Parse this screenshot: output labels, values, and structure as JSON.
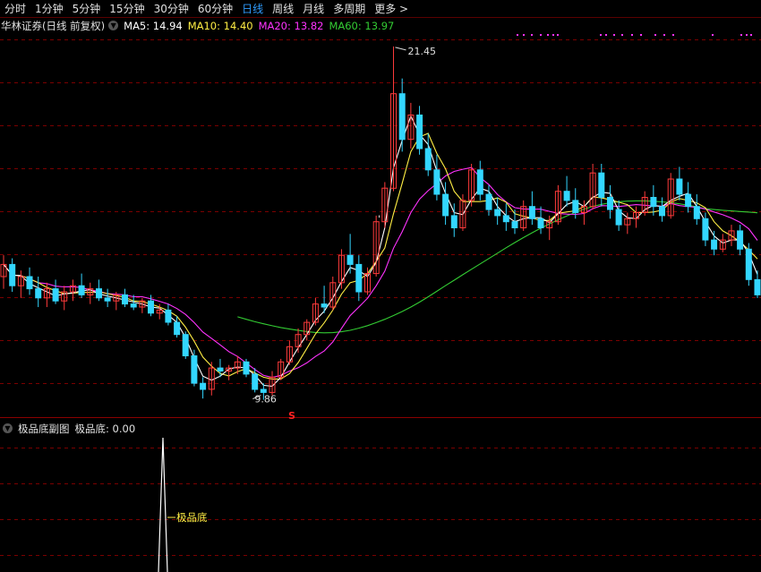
{
  "period_tabs": [
    "分时",
    "1分钟",
    "5分钟",
    "15分钟",
    "30分钟",
    "60分钟",
    "日线",
    "周线",
    "月线",
    "多周期",
    "更多 >"
  ],
  "active_tab": "日线",
  "main_panel": {
    "stock_title": "华林证券(日线 前复权)",
    "ma5_label": "MA5: 14.94",
    "ma10_label": "MA10: 14.40",
    "ma20_label": "MA20: 13.82",
    "ma60_label": "MA60: 13.97",
    "high_marker": "21.45",
    "low_marker": "9.86",
    "signal_marker": "S",
    "tick_marker": "'"
  },
  "sub_panel": {
    "title": "极品底副图",
    "value_label": "极品底: 0.00",
    "annotation": "极品底"
  },
  "colors": {
    "up": "#ff3b3b",
    "down": "#33d6ff",
    "ma5": "#ffffff",
    "ma10": "#ffee44",
    "ma20": "#ff33ff",
    "ma60": "#33cc33",
    "grid": "#7a0000",
    "active_tab": "#2f9dff"
  },
  "chart_data": {
    "type": "candlestick",
    "price_extremes": {
      "high": 21.45,
      "low": 9.86
    },
    "ohlc_approx": [
      [
        13.9,
        14.6,
        13.5,
        14.3
      ],
      [
        14.3,
        14.5,
        13.4,
        13.6
      ],
      [
        13.6,
        14.1,
        13.2,
        13.9
      ],
      [
        13.9,
        14.2,
        13.3,
        13.5
      ],
      [
        13.5,
        13.9,
        12.9,
        13.2
      ],
      [
        13.2,
        13.7,
        12.9,
        13.5
      ],
      [
        13.5,
        13.8,
        13.0,
        13.1
      ],
      [
        13.1,
        13.6,
        12.8,
        13.4
      ],
      [
        13.4,
        13.8,
        13.1,
        13.6
      ],
      [
        13.6,
        14.0,
        13.2,
        13.3
      ],
      [
        13.3,
        13.7,
        13.0,
        13.5
      ],
      [
        13.5,
        13.8,
        13.1,
        13.2
      ],
      [
        13.2,
        13.5,
        12.9,
        13.1
      ],
      [
        13.1,
        13.4,
        12.8,
        13.3
      ],
      [
        13.3,
        13.5,
        12.9,
        13.0
      ],
      [
        13.0,
        13.3,
        12.8,
        12.9
      ],
      [
        12.9,
        13.2,
        12.7,
        13.1
      ],
      [
        13.1,
        13.3,
        12.6,
        12.7
      ],
      [
        12.7,
        13.0,
        12.5,
        12.8
      ],
      [
        12.8,
        13.0,
        12.3,
        12.4
      ],
      [
        12.4,
        12.6,
        11.9,
        12.0
      ],
      [
        12.0,
        12.1,
        11.2,
        11.3
      ],
      [
        11.3,
        11.5,
        10.3,
        10.4
      ],
      [
        10.4,
        10.6,
        9.9,
        10.2
      ],
      [
        10.2,
        11.1,
        10.0,
        10.9
      ],
      [
        10.9,
        11.2,
        10.6,
        10.8
      ],
      [
        10.8,
        11.0,
        10.5,
        10.9
      ],
      [
        10.9,
        11.3,
        10.7,
        11.1
      ],
      [
        11.1,
        11.2,
        10.6,
        10.7
      ],
      [
        10.7,
        10.9,
        10.1,
        10.2
      ],
      [
        10.2,
        10.4,
        9.86,
        10.1
      ],
      [
        10.1,
        10.8,
        10.0,
        10.6
      ],
      [
        10.6,
        11.2,
        10.5,
        11.1
      ],
      [
        11.1,
        11.8,
        11.0,
        11.6
      ],
      [
        11.6,
        12.2,
        11.4,
        12.0
      ],
      [
        12.0,
        12.5,
        11.8,
        12.4
      ],
      [
        12.4,
        13.2,
        12.3,
        13.0
      ],
      [
        13.0,
        13.6,
        12.7,
        12.9
      ],
      [
        12.9,
        13.9,
        12.8,
        13.7
      ],
      [
        13.7,
        14.8,
        13.5,
        14.6
      ],
      [
        14.6,
        15.3,
        14.0,
        14.3
      ],
      [
        14.3,
        14.6,
        13.1,
        13.4
      ],
      [
        13.4,
        14.2,
        13.3,
        14.0
      ],
      [
        14.0,
        15.9,
        13.9,
        15.7
      ],
      [
        15.7,
        17.0,
        15.5,
        16.8
      ],
      [
        16.8,
        21.45,
        16.7,
        19.9
      ],
      [
        19.9,
        20.4,
        18.0,
        18.4
      ],
      [
        18.4,
        19.6,
        18.1,
        19.2
      ],
      [
        19.2,
        19.5,
        17.9,
        18.1
      ],
      [
        18.1,
        18.6,
        17.2,
        17.4
      ],
      [
        17.4,
        17.9,
        16.4,
        16.6
      ],
      [
        16.6,
        17.0,
        15.6,
        15.9
      ],
      [
        15.9,
        16.3,
        15.2,
        15.5
      ],
      [
        15.5,
        16.6,
        15.4,
        16.4
      ],
      [
        16.4,
        17.6,
        16.2,
        17.4
      ],
      [
        17.4,
        17.7,
        16.4,
        16.6
      ],
      [
        16.6,
        16.9,
        15.9,
        16.1
      ],
      [
        16.1,
        16.5,
        15.6,
        15.9
      ],
      [
        15.9,
        16.3,
        15.4,
        15.7
      ],
      [
        15.7,
        16.1,
        15.3,
        15.5
      ],
      [
        15.5,
        16.4,
        15.4,
        16.2
      ],
      [
        16.2,
        16.7,
        15.6,
        15.8
      ],
      [
        15.8,
        16.2,
        15.3,
        15.5
      ],
      [
        15.5,
        15.9,
        15.1,
        15.7
      ],
      [
        15.7,
        16.9,
        15.6,
        16.7
      ],
      [
        16.7,
        17.2,
        16.2,
        16.4
      ],
      [
        16.4,
        16.8,
        15.8,
        16.0
      ],
      [
        16.0,
        16.4,
        15.6,
        16.2
      ],
      [
        16.2,
        17.6,
        16.1,
        17.3
      ],
      [
        17.3,
        17.6,
        16.2,
        16.5
      ],
      [
        16.5,
        16.9,
        15.8,
        16.1
      ],
      [
        16.1,
        16.4,
        15.4,
        15.6
      ],
      [
        15.6,
        16.0,
        15.3,
        15.8
      ],
      [
        15.8,
        16.2,
        15.5,
        16.0
      ],
      [
        16.0,
        16.7,
        15.9,
        16.5
      ],
      [
        16.5,
        16.9,
        15.9,
        16.2
      ],
      [
        16.2,
        16.5,
        15.7,
        15.9
      ],
      [
        15.9,
        17.3,
        15.8,
        17.1
      ],
      [
        17.1,
        17.5,
        16.4,
        16.6
      ],
      [
        16.6,
        17.0,
        16.0,
        16.2
      ],
      [
        16.2,
        16.6,
        15.6,
        15.8
      ],
      [
        15.8,
        16.0,
        14.9,
        15.1
      ],
      [
        15.1,
        15.4,
        14.6,
        14.8
      ],
      [
        14.8,
        15.3,
        14.7,
        15.1
      ],
      [
        15.1,
        15.6,
        14.9,
        15.4
      ],
      [
        15.4,
        15.6,
        14.6,
        14.8
      ],
      [
        14.8,
        15.0,
        13.6,
        13.8
      ],
      [
        13.8,
        14.1,
        13.2,
        13.3
      ]
    ]
  }
}
